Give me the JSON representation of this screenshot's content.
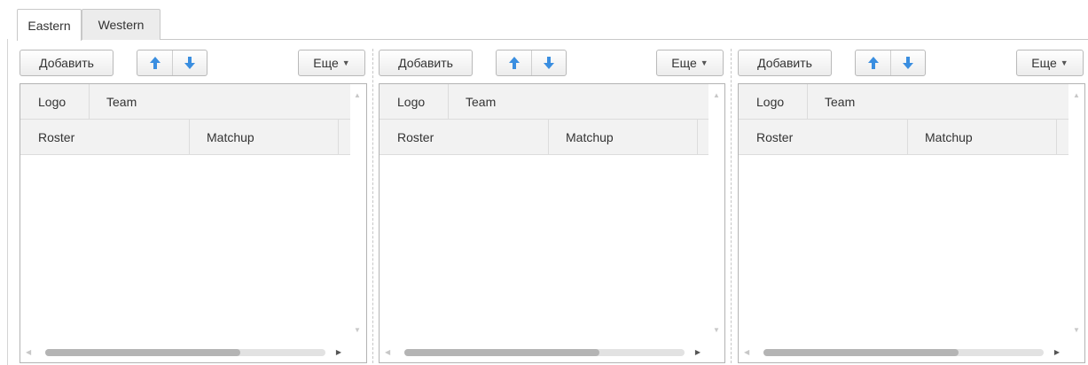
{
  "tabs": [
    {
      "label": "Eastern",
      "active": true
    },
    {
      "label": "Western",
      "active": false
    }
  ],
  "panels": [
    {
      "add_label": "Добавить",
      "more_label": "Еще",
      "header1": [
        "Logo",
        "Team"
      ],
      "header2": [
        "Roster",
        "Matchup"
      ]
    },
    {
      "add_label": "Добавить",
      "more_label": "Еще",
      "header1": [
        "Logo",
        "Team"
      ],
      "header2": [
        "Roster",
        "Matchup"
      ]
    },
    {
      "add_label": "Добавить",
      "more_label": "Еще",
      "header1": [
        "Logo",
        "Team"
      ],
      "header2": [
        "Roster",
        "Matchup"
      ]
    }
  ],
  "icons": {
    "move_up": "arrow-up-icon",
    "move_down": "arrow-down-icon",
    "more_caret": "caret-down-icon"
  },
  "colors": {
    "arrow": "#3a8ee0",
    "header_bg": "#f2f2f2",
    "scroll_thumb": "#b4b4b4"
  }
}
